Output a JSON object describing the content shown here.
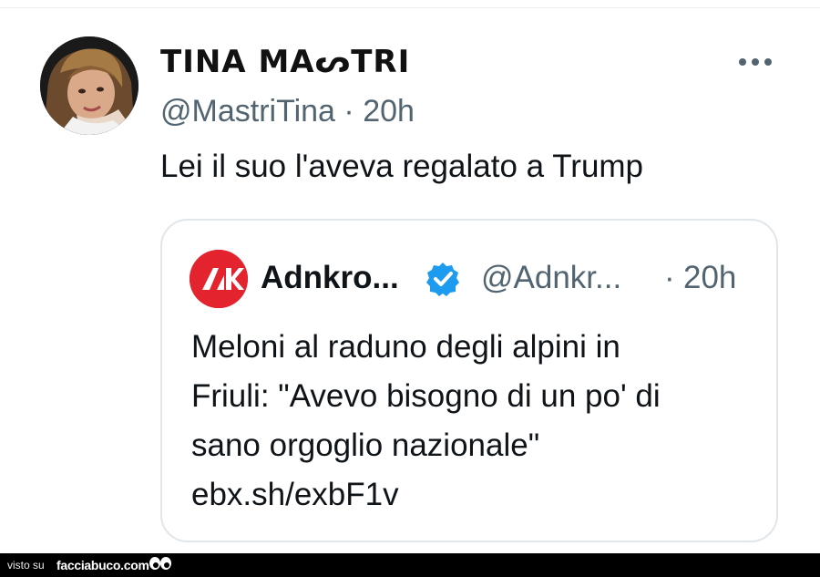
{
  "tweet": {
    "display_name": "TINA MAᔕTRI",
    "handle": "@MastriTina",
    "separator": "·",
    "time": "20h",
    "text": "Lei il suo l'aveva regalato a Trump",
    "avatar_icon": "user-photo-avatar",
    "more_icon": "more-options-icon"
  },
  "quote": {
    "logo_icon": "adnkronos-logo",
    "name": "Adnkro...",
    "verified_icon": "verified-badge-icon",
    "handle": "@Adnkr...",
    "separator": "·",
    "time": "20h",
    "text_lines": [
      "Meloni al raduno degli alpini in",
      "Friuli: \"Avevo bisogno di un po' di",
      "sano orgoglio nazionale\"",
      "ebx.sh/exbF1v"
    ]
  },
  "footer": {
    "visto_label": "visto su",
    "site_label": "facciabuco.com",
    "eyes_icon": "eyes-icon"
  },
  "colors": {
    "text": "#0f1419",
    "secondary": "#536471",
    "border": "#e1e6ea",
    "verified": "#1d9bf0",
    "logo_red": "#e3232e",
    "footer_bg": "#000000"
  }
}
